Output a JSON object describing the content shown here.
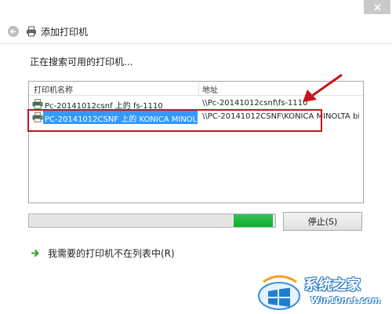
{
  "window": {
    "title": "添加打印机",
    "close_icon": "close-icon",
    "back_icon": "back-arrow-icon",
    "title_icon": "printer-icon"
  },
  "status": {
    "heading": "正在搜索可用的打印机..."
  },
  "list": {
    "columns": [
      "打印机名称",
      "地址"
    ],
    "rows": [
      {
        "name": "Pc-20141012csnf 上的 fs-1110",
        "address": "\\\\Pc-20141012csnf\\fs-1110",
        "icon": "printer-icon",
        "selected": false
      },
      {
        "name": "PC-20141012CSNF 上的 KONICA MINOL...",
        "address": "\\\\PC-20141012CSNF\\KONICA MINOLTA bi...",
        "icon": "printer-icon",
        "selected": true
      }
    ]
  },
  "progress": {
    "indeterminate": true,
    "segment_start": 0.83,
    "segment_end": 0.99,
    "color": "#06b025"
  },
  "buttons": {
    "stop": "停止(S)"
  },
  "link": {
    "missing_printer": "我需要的打印机不在列表中(R)",
    "icon": "green-arrow-icon"
  },
  "annotation": {
    "highlight_color": "#c8141c"
  },
  "watermark": {
    "title": "系统之家",
    "url": "Win10net.com"
  },
  "colors": {
    "selection": "#3399ff",
    "close_button": "#c9c9c9",
    "progress_green": "#06b025",
    "link_arrow": "#2aa336"
  }
}
